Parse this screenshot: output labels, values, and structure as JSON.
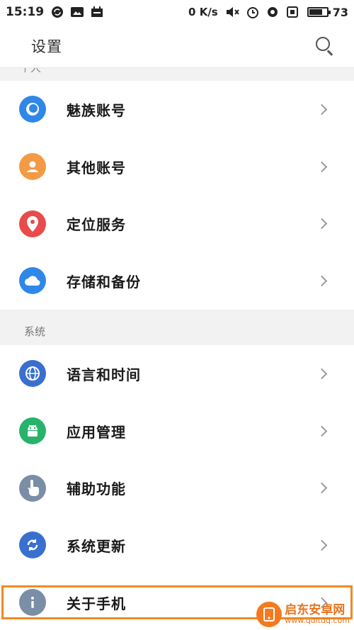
{
  "status_bar": {
    "time": "15:19",
    "net_speed": "0 K/s",
    "battery_level": "73",
    "battery_fraction": 0.73
  },
  "header": {
    "title": "设置"
  },
  "section_cut_label": "个人",
  "account_items": [
    {
      "label": "魅族账号",
      "icon": "meizu-account-icon",
      "color": "#2f87e8"
    },
    {
      "label": "其他账号",
      "icon": "user-icon",
      "color": "#f39a45"
    },
    {
      "label": "定位服务",
      "icon": "location-pin-icon",
      "color": "#e94b4b"
    },
    {
      "label": "存储和备份",
      "icon": "cloud-icon",
      "color": "#2f87e8"
    }
  ],
  "system_section": {
    "title": "系统",
    "items": [
      {
        "label": "语言和时间",
        "icon": "globe-icon",
        "color": "#3a6fd0"
      },
      {
        "label": "应用管理",
        "icon": "android-icon",
        "color": "#28b36a"
      },
      {
        "label": "辅助功能",
        "icon": "hand-pointer-icon",
        "color": "#7a8ea6"
      },
      {
        "label": "系统更新",
        "icon": "refresh-icon",
        "color": "#3a6fd0"
      },
      {
        "label": "关于手机",
        "icon": "info-icon",
        "color": "#7a8ea6"
      }
    ]
  },
  "watermark": {
    "name": "启东安卓网",
    "url": "www.qdltdq.com"
  }
}
